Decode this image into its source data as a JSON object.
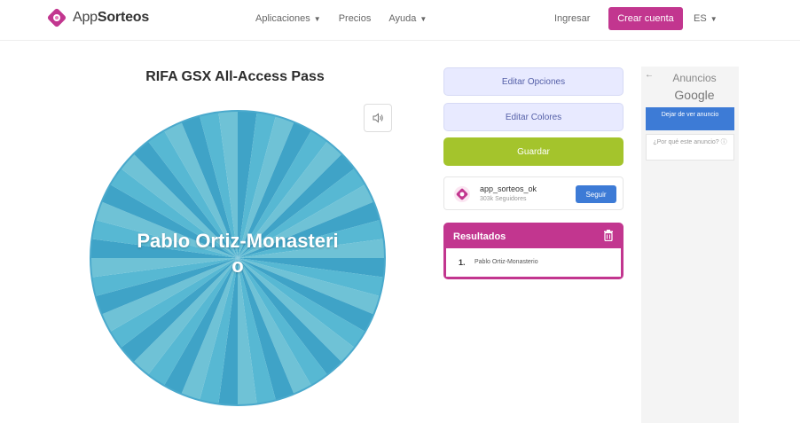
{
  "header": {
    "logo_prefix": "App",
    "logo_bold": "Sorteos",
    "nav": [
      {
        "label": "Aplicaciones",
        "has_dropdown": true
      },
      {
        "label": "Precios",
        "has_dropdown": false
      },
      {
        "label": "Ayuda",
        "has_dropdown": true
      }
    ],
    "login_label": "Ingresar",
    "signup_label": "Crear cuenta",
    "language": "ES"
  },
  "wheel": {
    "title": "RIFA GSX All-Access Pass",
    "winner_line1": "Pablo Ortiz-Monasteri",
    "winner_line2": "o",
    "colors": [
      "#3fa3c7",
      "#57b8d3",
      "#6fc2d6"
    ]
  },
  "actions": {
    "edit_options": "Editar Opciones",
    "edit_colors": "Editar Colores",
    "save": "Guardar"
  },
  "follow": {
    "username": "app_sorteos_ok",
    "followers": "303k Seguidores",
    "follow_label": "Seguir"
  },
  "results": {
    "title": "Resultados",
    "items": [
      {
        "number": "1.",
        "name": "Pablo Ortiz-Monasterio"
      }
    ]
  },
  "ads": {
    "label": "Anuncios",
    "google": "Google",
    "stop_label": "Dejar de ver anuncio",
    "why_label": "¿Por qué este anuncio? ⓘ"
  },
  "colors": {
    "brand": "#c2368f",
    "save_green": "#a4c42c",
    "option_bg": "#e8eaff",
    "follow_blue": "#3d7bd6"
  }
}
